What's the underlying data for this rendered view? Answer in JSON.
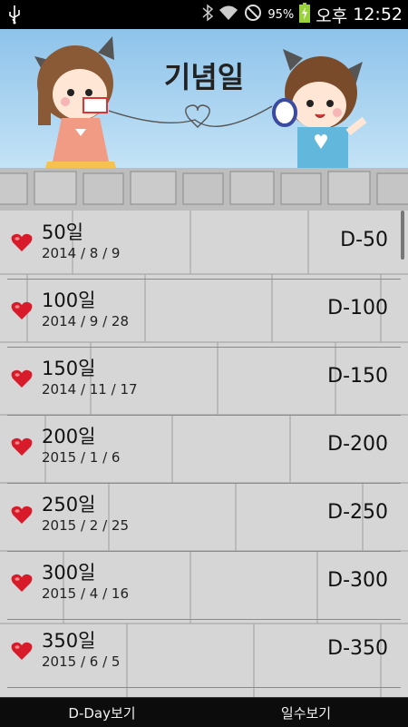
{
  "status_bar": {
    "battery_percent": "95%",
    "ampm": "오후",
    "time": "12:52",
    "icons": [
      "usb-icon",
      "bluetooth-icon",
      "wifi-icon",
      "mute-icon",
      "battery-icon"
    ]
  },
  "header": {
    "title": "기념일"
  },
  "anniversaries": [
    {
      "name": "50일",
      "date": "2014 / 8 / 9",
      "dday": "D-50"
    },
    {
      "name": "100일",
      "date": "2014 / 9 / 28",
      "dday": "D-100"
    },
    {
      "name": "150일",
      "date": "2014 / 11 / 17",
      "dday": "D-150"
    },
    {
      "name": "200일",
      "date": "2015 / 1 / 6",
      "dday": "D-200"
    },
    {
      "name": "250일",
      "date": "2015 / 2 / 25",
      "dday": "D-250"
    },
    {
      "name": "300일",
      "date": "2015 / 4 / 16",
      "dday": "D-300"
    },
    {
      "name": "350일",
      "date": "2015 / 6 / 5",
      "dday": "D-350"
    }
  ],
  "tabs": {
    "dday": "D-Day보기",
    "days": "일수보기"
  },
  "colors": {
    "heart": "#d81b2a",
    "sky": "#8ec3ea",
    "wall": "#d4d4d4"
  }
}
